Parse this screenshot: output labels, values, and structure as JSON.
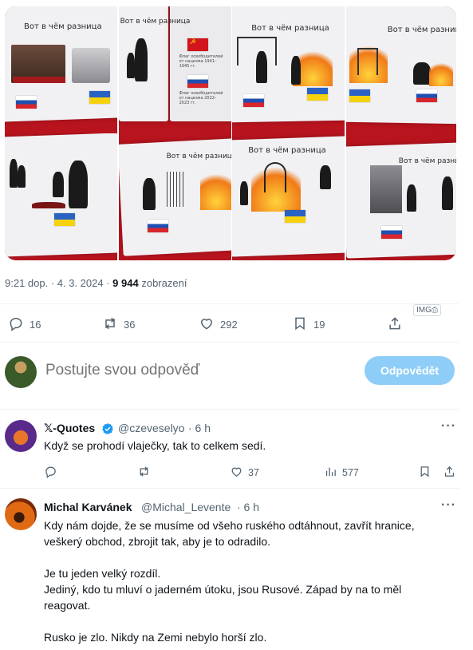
{
  "post": {
    "image_captions": {
      "title": "Вот в чём разница",
      "flag_caption_1": "Флаг освободителей от нацизма 1941–1945 гг.",
      "flag_caption_2": "Флаг освободителей от нацизма 2022–2023 гг."
    },
    "timestamp": "9:21 dop. · 4. 3. 2024",
    "dot": " · ",
    "views_count": "9 944",
    "views_label": "zobrazení",
    "stats": {
      "replies": "16",
      "reposts": "36",
      "likes": "292",
      "bookmarks": "19"
    },
    "img_badge": "IMG⎙"
  },
  "composer": {
    "placeholder": "Postujte svou odpověď",
    "reply_button": "Odpovědět"
  },
  "replies": [
    {
      "name": "𝕏-Quotes",
      "handle": "@czeveselyo",
      "time": "· 6 h",
      "verified": true,
      "text": "Když se prohodí vlaječky, tak to celkem sedí.",
      "stats": {
        "likes": "37",
        "views": "577"
      }
    },
    {
      "name": "Michal Karvánek",
      "handle": "@Michal_Levente",
      "time": "· 6 h",
      "paragraphs": [
        "Kdy nám dojde, že se musíme od všeho ruského odtáhnout, zavřít hranice, veškerý obchod, zbrojit tak, aby je to odradilo.",
        "Je tu jeden velký rozdíl.\nJediný, kdo tu mluví o jaderném útoku, jsou Rusové. Západ by na to měl reagovat.",
        "Rusko je zlo. Nikdy na Zemi nebylo horší zlo."
      ]
    }
  ],
  "colors": {
    "accent": "#1d9bf0",
    "accent_disabled": "#8ecdf8",
    "verified": "#1d9bf0",
    "muted": "#536471",
    "book_red": "#b8141e"
  },
  "icons": [
    "reply-icon",
    "repost-icon",
    "like-icon",
    "bookmark-icon",
    "share-icon",
    "views-icon",
    "verified-icon",
    "more-icon"
  ]
}
